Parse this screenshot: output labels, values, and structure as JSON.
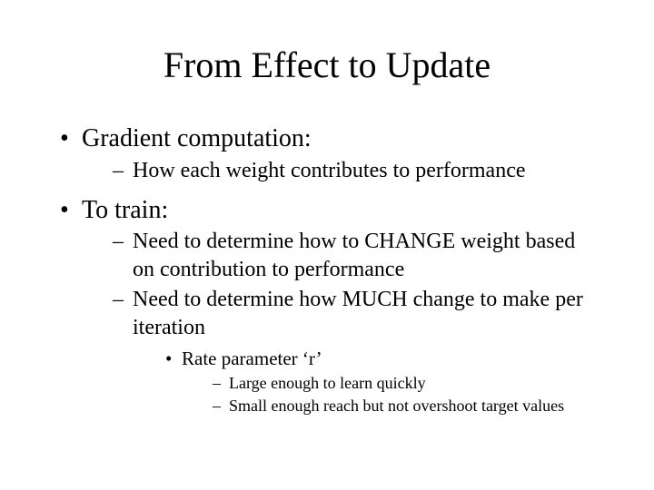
{
  "title": "From Effect to Update",
  "b1": "Gradient computation:",
  "b1_1": "How each weight contributes to performance",
  "b2": "To train:",
  "b2_1": "Need to determine how to CHANGE weight based on contribution to performance",
  "b2_2": "Need to determine how MUCH change to make per iteration",
  "b2_2_1": "Rate parameter  ‘r’",
  "b2_2_1_1": "Large enough to learn quickly",
  "b2_2_1_2": "Small enough reach but not overshoot target values"
}
